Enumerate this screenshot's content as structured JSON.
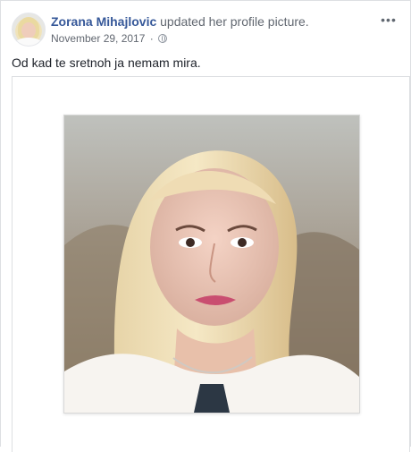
{
  "post": {
    "author_name": "Zorana Mihajlovic",
    "action_text": " updated her profile picture.",
    "date": "November 29, 2017",
    "separator": "·",
    "privacy_icon": "globe-icon",
    "more_icon": "ellipsis-icon",
    "more_label": "•••",
    "status_text": "Od kad te sretnoh ja nemam mira."
  },
  "colors": {
    "name": "#365899",
    "secondary_text": "#616770",
    "border": "#dddfe2"
  }
}
